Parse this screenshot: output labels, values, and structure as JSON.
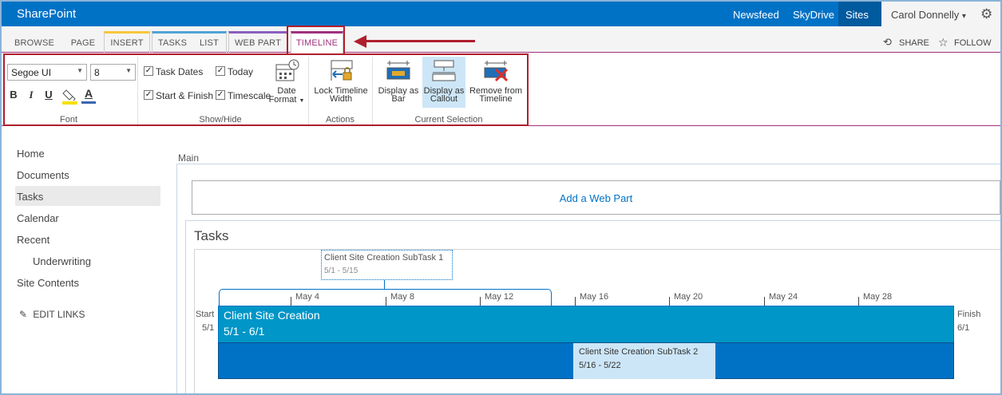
{
  "suite_bar": {
    "brand": "SharePoint",
    "links": [
      "Newsfeed",
      "SkyDrive",
      "Sites"
    ],
    "user": "Carol Donnelly",
    "user_caret": "▾",
    "settings_icon": "gear-icon"
  },
  "tabs": {
    "browse": "BROWSE",
    "page": "PAGE",
    "insert": "INSERT",
    "tasks": "TASKS",
    "list": "LIST",
    "web_part": "WEB PART",
    "timeline": "TIMELINE"
  },
  "actions": {
    "share": "SHARE",
    "follow": "FOLLOW"
  },
  "ribbon": {
    "font": {
      "label": "Font",
      "family": "Segoe UI",
      "size": "8",
      "bold": "B",
      "italic": "I",
      "underline": "U",
      "font_color": "A"
    },
    "show_hide": {
      "label": "Show/Hide",
      "task_dates": "Task Dates",
      "task_dates_checked": true,
      "today": "Today",
      "today_checked": true,
      "start_finish": "Start & Finish",
      "start_finish_checked": true,
      "timescale": "Timescale",
      "timescale_checked": true,
      "date_format_line1": "Date",
      "date_format_line2": "Format"
    },
    "actions": {
      "label": "Actions",
      "lock_line1": "Lock Timeline",
      "lock_line2": "Width"
    },
    "current_selection": {
      "label": "Current Selection",
      "bar_line1": "Display as",
      "bar_line2": "Bar",
      "callout_line1": "Display as",
      "callout_line2": "Callout",
      "remove_line1": "Remove from",
      "remove_line2": "Timeline"
    }
  },
  "nav": {
    "items": [
      "Home",
      "Documents",
      "Tasks",
      "Calendar",
      "Recent",
      "Underwriting",
      "Site Contents"
    ],
    "selected": "Tasks",
    "edit_links": "EDIT LINKS"
  },
  "content": {
    "zone_label": "Main",
    "add_web_part": "Add a Web Part",
    "web_part_title": "Tasks"
  },
  "timeline": {
    "start_label": "Start",
    "start_date": "5/1",
    "finish_label": "Finish",
    "finish_date": "6/1",
    "ticks": [
      "May 4",
      "May 8",
      "May 12",
      "May 16",
      "May 20",
      "May 24",
      "May 28"
    ],
    "callout_task": {
      "name": "Client Site Creation SubTask 1",
      "dates": "5/1 - 5/15"
    },
    "main_task": {
      "name": "Client Site Creation",
      "dates": "5/1 - 6/1"
    },
    "sub_task": {
      "name": "Client Site Creation SubTask 2",
      "dates": "5/16 - 5/22"
    }
  },
  "colors": {
    "suite_blue": "#0072c6",
    "timeline_accent": "#a0317f",
    "annotation_red": "#b01e2c",
    "main_bar": "#0096c7",
    "sub_bar": "#cde6f7"
  }
}
